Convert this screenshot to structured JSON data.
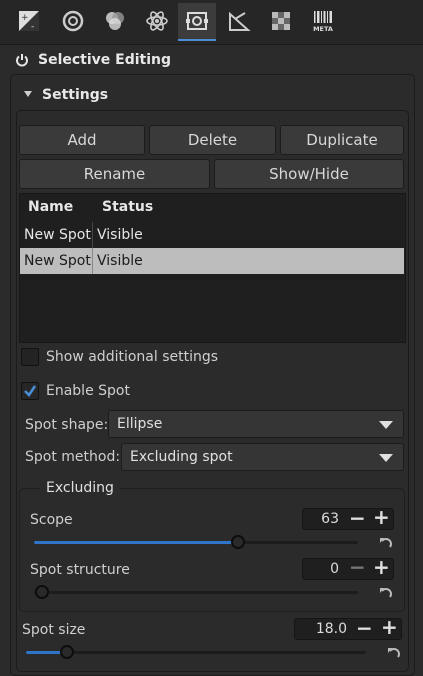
{
  "toolbar": {
    "tabs": [
      {
        "icon": "exposure-icon"
      },
      {
        "icon": "detail-icon"
      },
      {
        "icon": "color-icon"
      },
      {
        "icon": "advanced-icon"
      },
      {
        "icon": "local-adjustments-icon",
        "active": true
      },
      {
        "icon": "transform-icon"
      },
      {
        "icon": "raw-icon"
      },
      {
        "icon": "metadata-icon",
        "label": "META"
      }
    ]
  },
  "panel": {
    "title": "Selective Editing"
  },
  "settings": {
    "title": "Settings",
    "buttons": {
      "add": "Add",
      "delete": "Delete",
      "duplicate": "Duplicate",
      "rename": "Rename",
      "show_hide": "Show/Hide"
    },
    "table": {
      "columns": [
        "Name",
        "Status"
      ],
      "rows": [
        {
          "name": "New Spot",
          "status": "Visible",
          "selected": false
        },
        {
          "name": "New Spot",
          "status": "Visible",
          "selected": true
        }
      ]
    },
    "show_additional": {
      "label": "Show additional settings",
      "checked": false
    },
    "enable_spot": {
      "label": "Enable Spot",
      "checked": true
    },
    "spot_shape": {
      "label": "Spot shape:",
      "value": "Ellipse"
    },
    "spot_method": {
      "label": "Spot method:",
      "value": "Excluding spot"
    },
    "excluding": {
      "title": "Excluding",
      "scope": {
        "label": "Scope",
        "value": "63",
        "fraction": 0.63
      },
      "structure": {
        "label": "Spot structure",
        "value": "0",
        "fraction": 0.0
      }
    },
    "spot_size": {
      "label": "Spot size",
      "value": "18.0",
      "fraction": 0.12
    }
  },
  "colors": {
    "accent": "#2f74c9",
    "active_tab": "#4a8ed8"
  }
}
